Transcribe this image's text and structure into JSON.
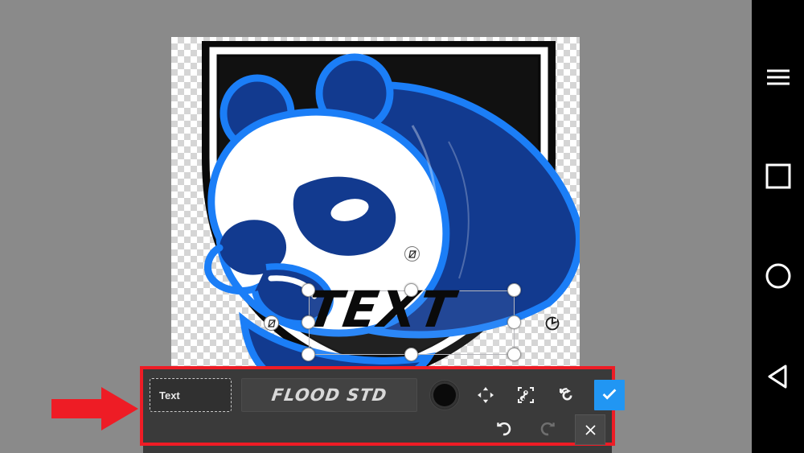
{
  "app": {
    "name": "photo-editor-text-tool",
    "background_color": "#8a8a8a"
  },
  "canvas": {
    "name": "image-canvas",
    "transparency_checker": true,
    "artwork_description": "Blue and white panda mascot on black shield crest",
    "colors": {
      "bright_blue": "#1b7ef7",
      "navy": "#0d2f85",
      "white": "#ffffff",
      "black": "#0a0a0a"
    },
    "text_layer": {
      "value": "TEXT",
      "color": "#0a0a0a",
      "selected": true
    },
    "selection": {
      "handle_count": 8,
      "handle_color": "#ffffff",
      "border_color": "#b8b8bd"
    },
    "rotate_handle_label": "rotate",
    "skew_handle_label": "skew"
  },
  "toolbar": {
    "name": "text-edit-toolbar",
    "highlight_color": "#ee1c25",
    "text_input": {
      "value": "Text",
      "placeholder": "Text"
    },
    "font_field": {
      "value": "FLOOD STD"
    },
    "color_swatch": {
      "value": "#000000",
      "label": "color"
    },
    "tools": [
      {
        "id": "move-tool",
        "label": "Move"
      },
      {
        "id": "transform-tool",
        "label": "Transform"
      },
      {
        "id": "flip-tool",
        "label": "Flip"
      }
    ],
    "confirm_label": "Apply",
    "cancel_label": "Cancel",
    "undo_label": "Undo",
    "redo_label": "Redo",
    "redo_enabled": false,
    "accent_color": "#2196f3"
  },
  "annotation": {
    "name": "red-pointer-arrow",
    "color": "#ee1c25",
    "direction": "right"
  },
  "navbar": {
    "name": "android-navigation-bar",
    "background": "#000000",
    "items": [
      {
        "id": "menu",
        "label": "Menu"
      },
      {
        "id": "recents",
        "label": "Recents"
      },
      {
        "id": "home",
        "label": "Home"
      },
      {
        "id": "back",
        "label": "Back"
      }
    ]
  }
}
